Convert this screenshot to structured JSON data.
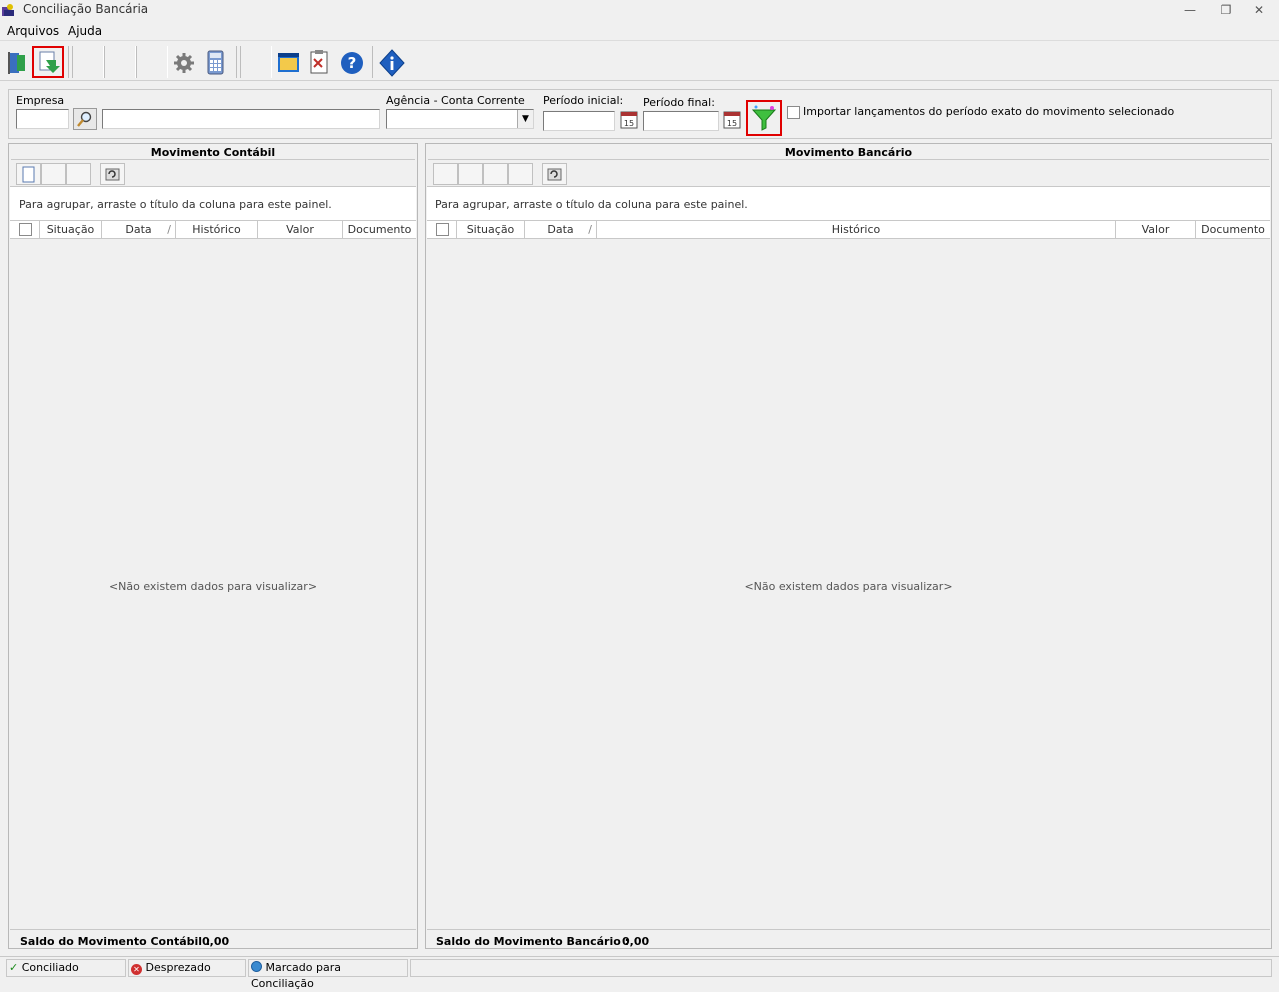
{
  "window": {
    "title": "Conciliação Bancária"
  },
  "menu": {
    "items": [
      "Arquivos",
      "Ajuda"
    ]
  },
  "filter": {
    "empresa_label": "Empresa",
    "agencia_label": "Agência - Conta Corrente",
    "periodo_inicial_label": "Período inicial:",
    "periodo_final_label": "Período final:",
    "checkbox_label": "Importar lançamentos do período exato do movimento selecionado"
  },
  "left_pane": {
    "title": "Movimento Contábil",
    "group_hint": "Para agrupar, arraste o título da coluna para este painel.",
    "columns": [
      "Situação",
      "Data",
      "Histórico",
      "Valor",
      "Documento"
    ],
    "nodata": "<Não existem dados para visualizar>",
    "saldo_label": "Saldo do Movimento Contábil :",
    "saldo_value": "0,00"
  },
  "right_pane": {
    "title": "Movimento Bancário",
    "group_hint": "Para agrupar, arraste o título da coluna para este painel.",
    "columns": [
      "Situação",
      "Data",
      "Histórico",
      "Valor",
      "Documento"
    ],
    "nodata": "<Não existem dados para visualizar>",
    "saldo_label": "Saldo do Movimento Bancário :",
    "saldo_value": "0,00"
  },
  "status": {
    "conciliado": "Conciliado",
    "desprezado": "Desprezado",
    "marcado": "Marcado para Conciliação"
  },
  "colors": {
    "highlight": "#e00000"
  }
}
